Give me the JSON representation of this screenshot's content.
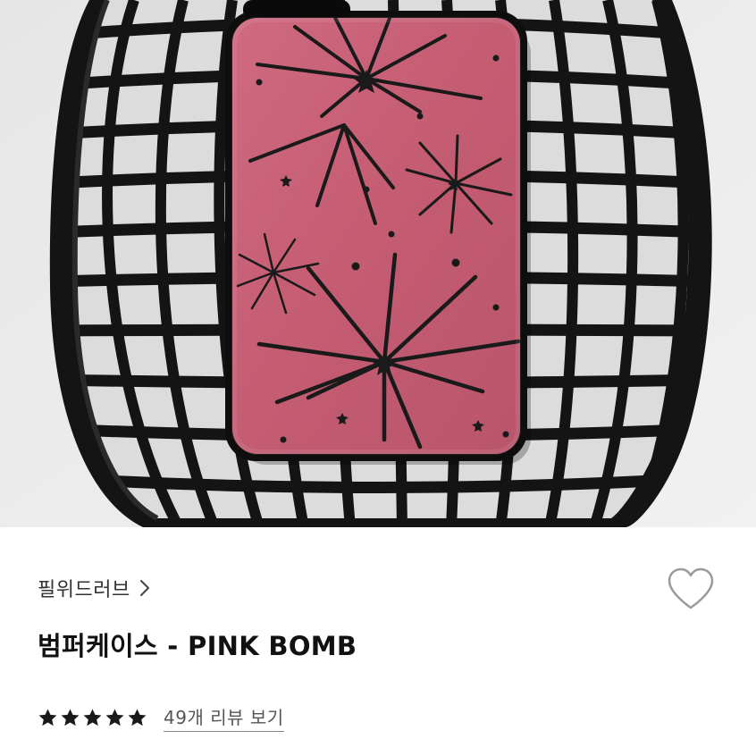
{
  "product": {
    "brand": "필위드러브",
    "title": "범퍼케이스 - PINK BOMB",
    "rating": 5,
    "rating_max": 5,
    "review_link": "49개 리뷰 보기"
  },
  "icons": {
    "brand_chevron": "chevron-right-icon",
    "wishlist": "heart-outline-icon",
    "rating": "star-filled-icon"
  },
  "colors": {
    "case_pink": "#c45c72",
    "basket_black": "#141414",
    "background_gray": "#ebebeb",
    "star_color": "#1a1a1a",
    "heart_stroke": "#9a9a9a"
  }
}
